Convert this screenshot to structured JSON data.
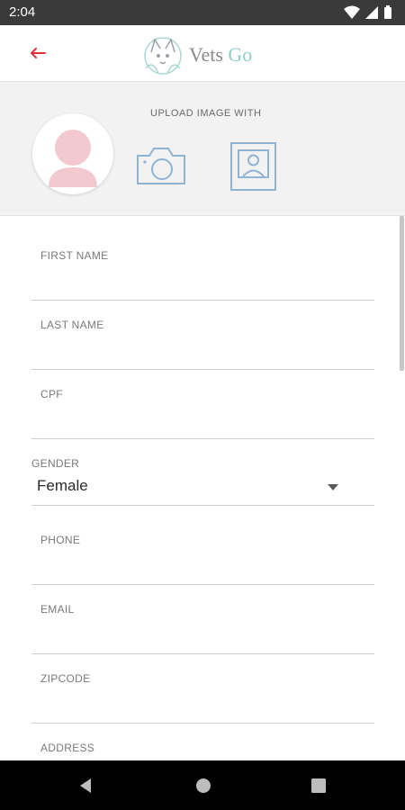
{
  "status_bar": {
    "time": "2:04",
    "icons": [
      "wifi-icon",
      "signal-icon",
      "battery-icon"
    ]
  },
  "header": {
    "back_icon": "arrow-left-icon",
    "logo_primary": "Vets",
    "logo_secondary": "Go",
    "accent_color": "#e0313a",
    "logo_accent_color": "#8fcfc6"
  },
  "upload": {
    "label": "UPLOAD IMAGE WITH",
    "options": [
      "camera-icon",
      "gallery-icon"
    ],
    "icon_color": "#8fb3d3",
    "avatar_color": "#f2c9cf"
  },
  "form": {
    "first_name_label": "FIRST NAME",
    "last_name_label": "LAST NAME",
    "cpf_label": "CPF",
    "gender_label": "GENDER",
    "gender_value": "Female",
    "phone_label": "PHONE",
    "email_label": "EMAIL",
    "zipcode_label": "ZIPCODE",
    "address_label": "ADDRESS"
  },
  "nav_bar": {
    "buttons": [
      "back-triangle-icon",
      "home-circle-icon",
      "recents-square-icon"
    ]
  }
}
